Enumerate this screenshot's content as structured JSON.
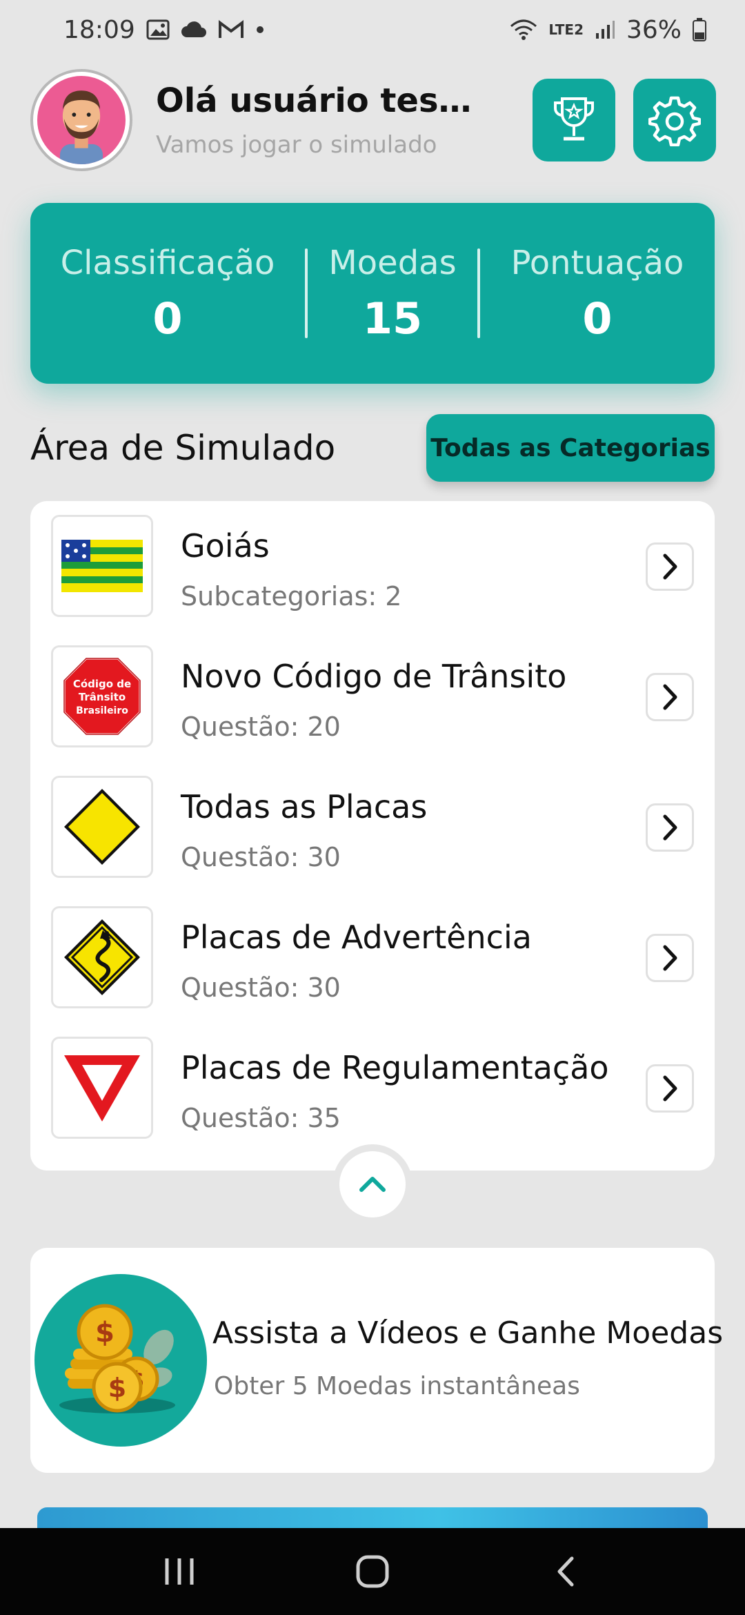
{
  "status_bar": {
    "time": "18:09",
    "network": "LTE2",
    "battery": "36%"
  },
  "header": {
    "greeting": "Olá usuário teste ...",
    "subtitle": "Vamos jogar o simulado",
    "trophy_icon": "trophy-icon",
    "settings_icon": "gear-icon"
  },
  "stats": {
    "rank_label": "Classificação",
    "rank_value": "0",
    "coins_label": "Moedas",
    "coins_value": "15",
    "score_label": "Pontuação",
    "score_value": "0"
  },
  "section": {
    "title": "Área de Simulado",
    "all_button": "Todas as Categorias"
  },
  "categories": [
    {
      "title": "Goiás",
      "subtitle": "Subcategorias: 2",
      "icon": "goias-flag-icon"
    },
    {
      "title": "Novo Código de Trânsito",
      "subtitle": "Questão: 20",
      "icon": "stop-sign-icon"
    },
    {
      "title": "Todas as Placas",
      "subtitle": "Questão: 30",
      "icon": "yellow-diamond-sign-icon"
    },
    {
      "title": "Placas de Advertência",
      "subtitle": "Questão: 30",
      "icon": "winding-road-sign-icon"
    },
    {
      "title": "Placas de Regulamentação",
      "subtitle": "Questão: 35",
      "icon": "yield-sign-icon"
    }
  ],
  "stop_sign_text": [
    "Código de",
    "Trânsito",
    "Brasileiro"
  ],
  "reward": {
    "title": "Assista a Vídeos e Ganhe Moedas",
    "subtitle": "Obter 5 Moedas instantâneas",
    "icon": "coins-icon"
  },
  "colors": {
    "accent": "#0fa89c",
    "background": "#e6e6e6"
  }
}
